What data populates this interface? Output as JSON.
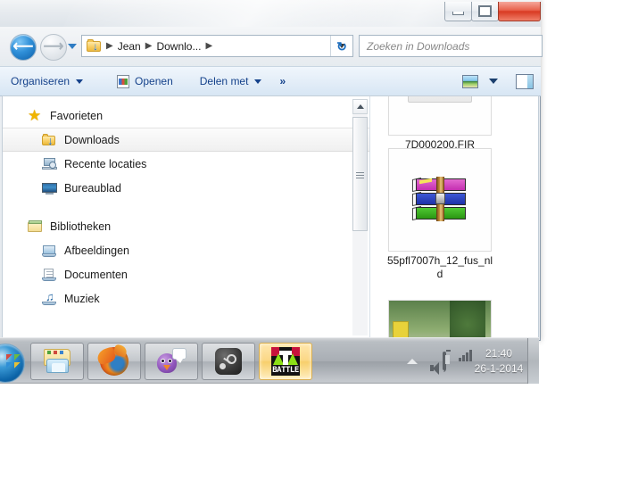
{
  "window": {
    "title_visible": "",
    "controls": {
      "minimize": "Minimaliseren",
      "maximize": "Maximaliseren",
      "close": "Sluiten"
    }
  },
  "address_bar": {
    "back_label": "Vorige",
    "forward_label": "Volgende",
    "history_label": "Recente locaties",
    "folder_icon": "downloads-folder-icon",
    "crumbs": [
      "Jean",
      "Downlo..."
    ],
    "separator": "▸",
    "refresh_label": "Vernieuwen"
  },
  "search": {
    "placeholder": "Zoeken in Downloads",
    "value": ""
  },
  "toolbar": {
    "organize_label": "Organiseren",
    "open_label": "Openen",
    "share_label": "Delen met",
    "overflow_label": "»",
    "view_label": "Beeldopties",
    "preview_pane_label": "Voorbeeldvenster"
  },
  "sidebar": {
    "groups": [
      {
        "name": "Favorieten",
        "icon": "star-icon",
        "items": [
          {
            "label": "Downloads",
            "icon": "downloads-folder-icon",
            "selected": true
          },
          {
            "label": "Recente locaties",
            "icon": "recent-locations-icon",
            "selected": false
          },
          {
            "label": "Bureaublad",
            "icon": "desktop-icon",
            "selected": false
          }
        ]
      },
      {
        "name": "Bibliotheken",
        "icon": "library-icon",
        "items": [
          {
            "label": "Afbeeldingen",
            "icon": "pictures-icon",
            "selected": false
          },
          {
            "label": "Documenten",
            "icon": "documents-icon",
            "selected": false
          },
          {
            "label": "Muziek",
            "icon": "music-icon",
            "selected": false
          }
        ]
      }
    ],
    "scrollbar": {
      "up_label": "Omhoog schuiven"
    }
  },
  "files": [
    {
      "name": "7D000200.FIR",
      "icon": "generic-file-icon"
    },
    {
      "name": "55pfl7007h_12_fus_nld",
      "icon": "winrar-archive-icon"
    },
    {
      "name": "",
      "icon": "photo-thumbnail"
    }
  ],
  "taskbar": {
    "start_label": "Start",
    "buttons": [
      {
        "name": "Windows Verkenner",
        "icon": "explorer-icon",
        "active": false
      },
      {
        "name": "Mozilla Firefox",
        "icon": "firefox-icon",
        "active": false
      },
      {
        "name": "Chat",
        "icon": "bird-chat-icon",
        "active": false
      },
      {
        "name": "Steam",
        "icon": "steam-icon",
        "active": false
      },
      {
        "name": "BATTLE",
        "icon": "battle-game-icon",
        "active": true,
        "badge_text": "BATTLE"
      }
    ],
    "tray": {
      "show_hidden_label": "Verborgen pictogrammen weergeven",
      "volume_label": "Volume",
      "battery_label": "Batterij",
      "network_label": "Netwerk",
      "time": "21:40",
      "date": "26-1-2014",
      "show_desktop_label": "Bureaublad weergeven"
    }
  },
  "colors": {
    "accent_blue": "#15428b",
    "selection": "#f0f0f0",
    "taskbar": "#a9aeb4",
    "close_red": "#d93a22",
    "active_button": "#fbd887"
  }
}
